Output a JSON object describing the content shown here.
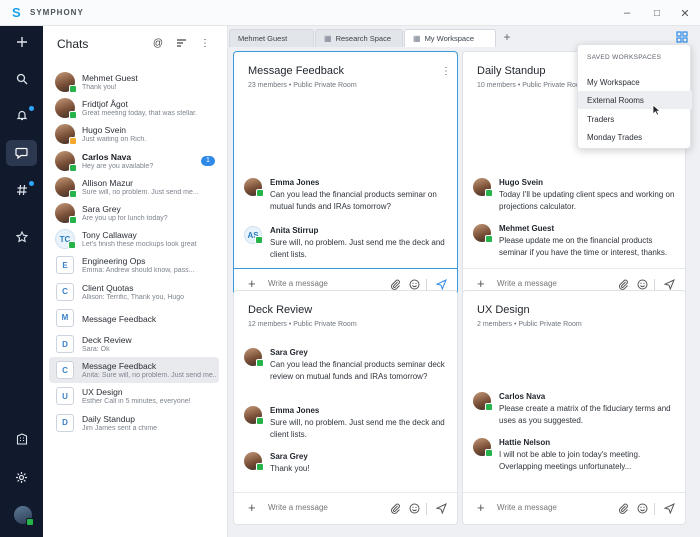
{
  "app": {
    "name": "SYMPHONY",
    "logo_letter": "S",
    "accent": "#1aa0e6"
  },
  "window_controls": {
    "minimize": "–",
    "maximize": "□",
    "close": "✕"
  },
  "rail": {
    "icons": [
      "plus-icon",
      "search-icon",
      "bell-icon",
      "chat-bubble-icon",
      "hashtag-icon",
      "star-icon",
      "building-icon",
      "gear-icon"
    ],
    "active": "chat-bubble-icon"
  },
  "chats": {
    "title": "Chats",
    "items": [
      {
        "name": "Mehmet Guest",
        "preview": "Thank you!",
        "avatar": "photo",
        "presence": "available"
      },
      {
        "name": "Fridtjof Ågot",
        "preview": "Great meeting today, that was stellar.",
        "avatar": "photo",
        "presence": "available"
      },
      {
        "name": "Hugo Svein",
        "preview": "Just waiting on Rich.",
        "avatar": "photo",
        "presence": "away"
      },
      {
        "name": "Carlos Nava",
        "preview": "Hey are you available?",
        "avatar": "photo",
        "presence": "available",
        "bold": true,
        "badge": "1"
      },
      {
        "name": "Allison Mazur",
        "preview": "Sure will, no problem. Just send me...",
        "avatar": "photo",
        "presence": "available"
      },
      {
        "name": "Sara Grey",
        "preview": "Are you up for lunch today?",
        "avatar": "photo",
        "presence": "available"
      },
      {
        "name": "Tony Callaway",
        "preview": "Let's finish these mockups look great",
        "avatar": "initials",
        "initials": "TC",
        "presence": "available"
      },
      {
        "name": "Engineering Ops",
        "preview": "Emma: Andrew should know, pass...",
        "avatar": "room",
        "initials": "E"
      },
      {
        "name": "Client Quotas",
        "preview": "Allison: Terrific, Thank you, Hugo",
        "avatar": "room",
        "initials": "C"
      },
      {
        "name": "Message Feedback",
        "preview": "",
        "avatar": "room",
        "initials": "M"
      },
      {
        "name": "Deck Review",
        "preview": "Sara: Ok",
        "avatar": "room",
        "initials": "D"
      },
      {
        "name": "Message Feedback",
        "preview": "Anita: Sure will, no problem. Just send me...",
        "avatar": "room",
        "initials": "C",
        "selected": true
      },
      {
        "name": "UX Design",
        "preview": "Esther Call in 5 minutes, everyone!",
        "avatar": "room",
        "initials": "U"
      },
      {
        "name": "Daily Standup",
        "preview": "Jim James sent a chime",
        "avatar": "room",
        "initials": "D"
      }
    ]
  },
  "tabs": [
    {
      "label": "Mehmet Guest",
      "icon": ""
    },
    {
      "label": "Research Space",
      "icon": "grid-icon"
    },
    {
      "label": "My Workspace",
      "icon": "grid-icon",
      "active": true
    }
  ],
  "cards": [
    {
      "title": "Message Feedback",
      "subtitle": "23 members • Public Private Room",
      "messages": [
        {
          "name": "Emma Jones",
          "text": "Can you lead the financial products seminar on mutual funds and IRAs tomorrow?",
          "avatar": "photo"
        },
        {
          "name": "Anita Stirrup",
          "text": "Sure will, no problem. Just send me the deck and client lists.",
          "avatar": "initials",
          "initials": "AS"
        }
      ]
    },
    {
      "title": "Daily Standup",
      "subtitle": "10 members • Public Private Room",
      "messages": [
        {
          "name": "Hugo Svein",
          "text": "Today I'll be updating client specs and working on projections calculator.",
          "avatar": "photo"
        },
        {
          "name": "Mehmet Guest",
          "text": "Please update me on the financial products seminar if you have the time or interest, thanks.",
          "avatar": "photo"
        }
      ]
    },
    {
      "title": "Deck Review",
      "subtitle": "12 members • Public Private Room",
      "messages": [
        {
          "name": "Sara Grey",
          "text": "Can you lead the financial products seminar deck review on mutual funds and IRAs tomorrow?",
          "avatar": "photo"
        },
        {
          "name": "Emma Jones",
          "text": "Sure will, no problem. Just send me the deck and client lists.",
          "avatar": "photo"
        },
        {
          "name": "Sara Grey",
          "text": "Thank you!",
          "avatar": "photo"
        }
      ]
    },
    {
      "title": "UX Design",
      "subtitle": "2 members • Public Private Room",
      "messages": [
        {
          "name": "Carlos Nava",
          "text": "Please create a matrix of the fiduciary terms and uses as you suggested.",
          "avatar": "photo"
        },
        {
          "name": "Hattie Nelson",
          "text": "I will not be able to join today's meeting. Overlapping meetings unfortunately...",
          "avatar": "photo"
        }
      ]
    }
  ],
  "composer": {
    "placeholder": "Write a message"
  },
  "dropdown": {
    "header": "SAVED WORKSPACES",
    "items": [
      {
        "label": "My Workspace"
      },
      {
        "label": "External Rooms",
        "hover": true
      },
      {
        "label": "Traders"
      },
      {
        "label": "Monday Trades"
      }
    ]
  }
}
